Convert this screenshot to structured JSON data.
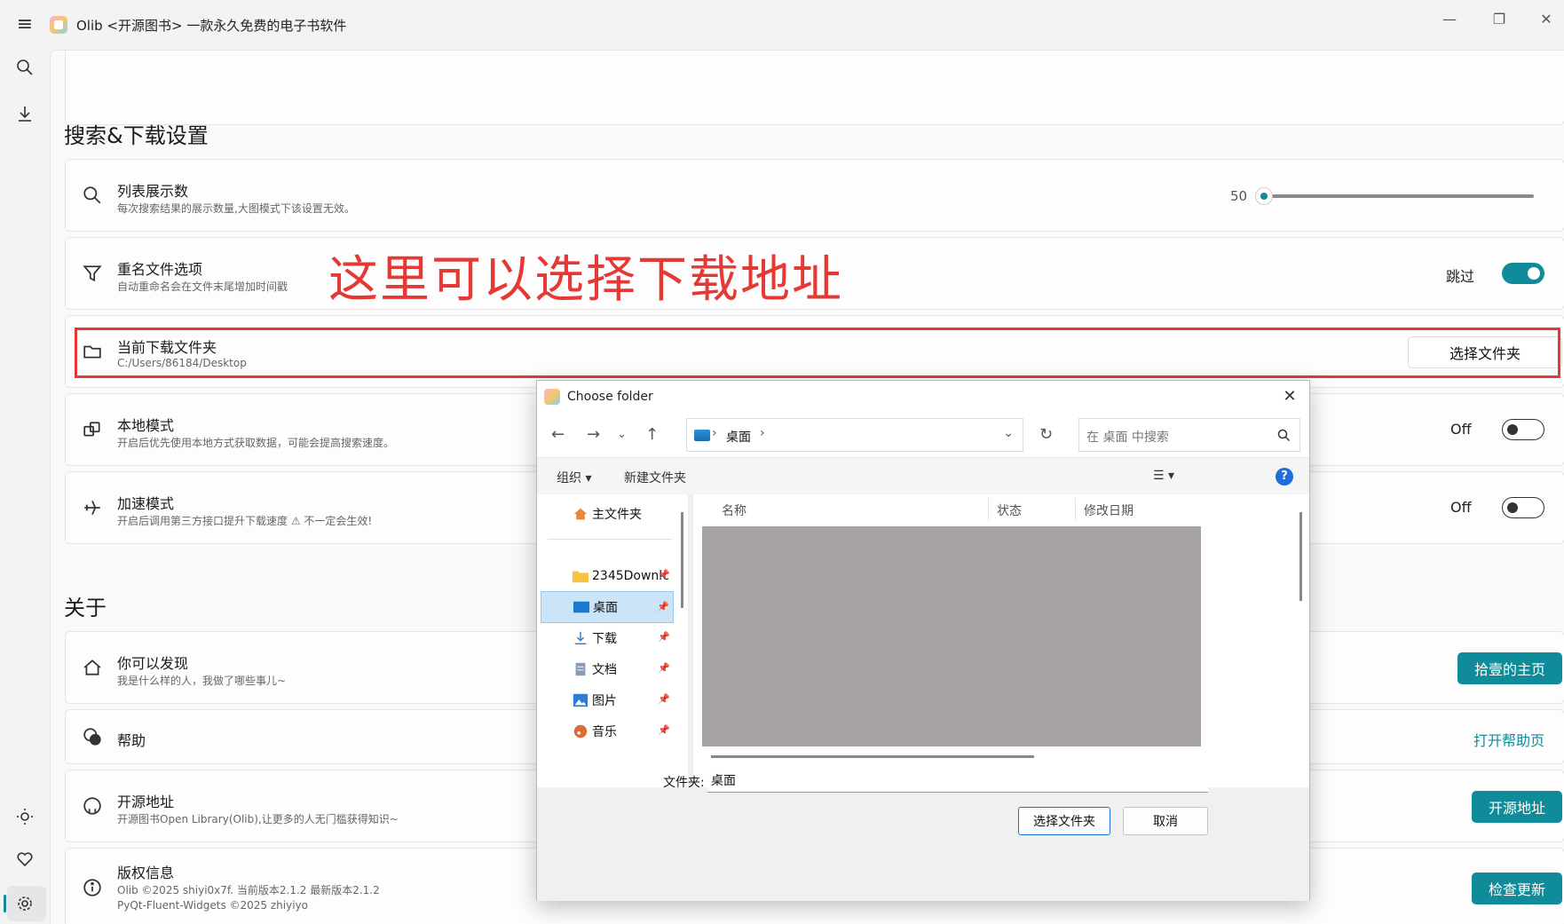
{
  "app": {
    "title": "Olib <开源图书> 一款永久免费的电子书软件"
  },
  "window": {
    "minimize": "—",
    "maximize": "❐",
    "close": "✕"
  },
  "sections": {
    "search_download": "搜索&下载设置",
    "about": "关于"
  },
  "settings": {
    "list_count": {
      "title": "列表展示数",
      "desc": "每次搜索结果的展示数量,大图模式下该设置无效。",
      "value": "50",
      "slider_fraction": 0.0
    },
    "rename": {
      "title": "重名文件选项",
      "desc": "自动重命名会在文件末尾增加时间戳",
      "state_label": "跳过"
    },
    "download_folder": {
      "title": "当前下载文件夹",
      "desc": "C:/Users/86184/Desktop",
      "button": "选择文件夹"
    },
    "local_mode": {
      "title": "本地模式",
      "desc": "开启后优先使用本地方式获取数据，可能会提高搜索速度。",
      "state_label": "Off"
    },
    "accel_mode": {
      "title": "加速模式",
      "desc": "开启后调用第三方接口提升下载速度 ⚠ 不一定会生效!",
      "state_label": "Off"
    }
  },
  "about": {
    "discover": {
      "title": "你可以发现",
      "desc": "我是什么样的人，我做了哪些事儿~",
      "button": "拾壹的主页"
    },
    "help": {
      "title": "帮助",
      "link": "打开帮助页"
    },
    "source": {
      "title": "开源地址",
      "desc": "开源图书Open Library(Olib),让更多的人无门槛获得知识~",
      "button": "开源地址"
    },
    "copyright": {
      "title": "版权信息",
      "desc1": "Olib ©2025 shiyi0x7f. 当前版本2.1.2 最新版本2.1.2",
      "desc2": "PyQt-Fluent-Widgets ©2025  zhiyiyo",
      "button": "检查更新"
    }
  },
  "annotation": "这里可以选择下载地址",
  "dialog": {
    "title": "Choose folder",
    "close": "✕",
    "address": {
      "sep": "›",
      "location": "桌面",
      "tail": "›"
    },
    "search_placeholder": "在 桌面 中搜索",
    "toolbar": {
      "organize": "组织 ▾",
      "new_folder": "新建文件夹",
      "view": "☰ ▾",
      "help": "?"
    },
    "sidebar": [
      {
        "label": "主文件夹",
        "icon": "home-icon"
      },
      {
        "label": "2345Downlc",
        "icon": "folder-icon",
        "pin": "📌"
      },
      {
        "label": "桌面",
        "icon": "desktop-icon",
        "pin": "📌",
        "active": true
      },
      {
        "label": "下载",
        "icon": "download-icon",
        "pin": "📌"
      },
      {
        "label": "文档",
        "icon": "document-icon",
        "pin": "📌"
      },
      {
        "label": "图片",
        "icon": "pictures-icon",
        "pin": "📌"
      },
      {
        "label": "音乐",
        "icon": "music-icon",
        "pin": "📌"
      }
    ],
    "columns": {
      "name": "名称",
      "status": "状态",
      "modified": "修改日期"
    },
    "folder_label": "文件夹:",
    "folder_value": "桌面",
    "select_button": "选择文件夹",
    "cancel_button": "取消"
  },
  "colors": {
    "accent": "#0f8b9a",
    "annotation": "#e53935",
    "dialog_blue": "#1e6fd9"
  }
}
